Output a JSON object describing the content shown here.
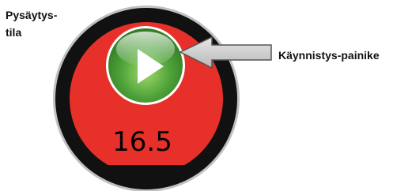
{
  "device": {
    "state_label_line1": "Pysäytys-",
    "state_label_line2": "tila",
    "display_value": "16.5",
    "start_button_label": "Käynnistys-painike",
    "start_button_icon": "play-icon",
    "colors": {
      "face": "#e8302a",
      "bezel": "#111111",
      "button": "#4fa33a"
    }
  }
}
